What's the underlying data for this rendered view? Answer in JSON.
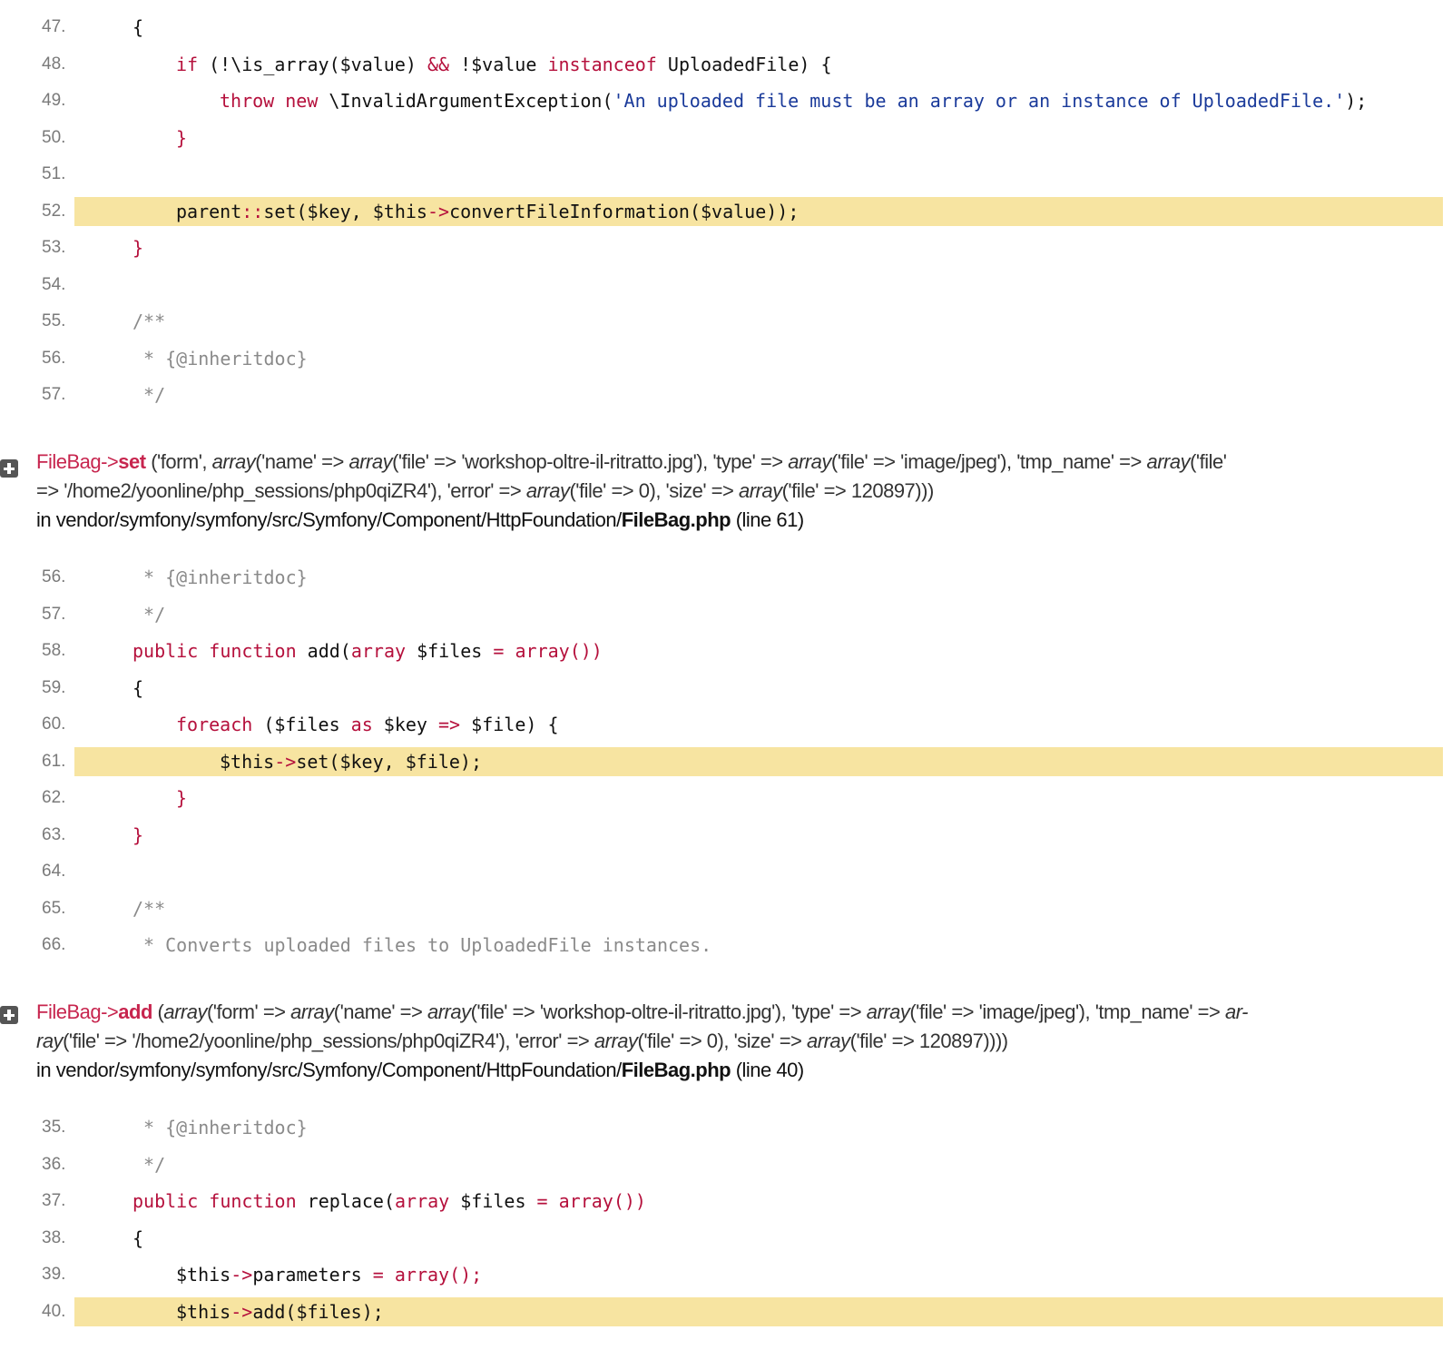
{
  "block1": {
    "lines": [
      {
        "n": "47.",
        "ind": 1,
        "hl": false,
        "tokens": [
          [
            "t",
            "{"
          ]
        ]
      },
      {
        "n": "48.",
        "ind": 2,
        "hl": false,
        "tokens": [
          [
            "k",
            "if"
          ],
          [
            "t",
            " (!\\is_array($value) "
          ],
          [
            "k",
            "&&"
          ],
          [
            "t",
            " !$value "
          ],
          [
            "k",
            "instanceof"
          ],
          [
            "t",
            " UploadedFile) {"
          ]
        ]
      },
      {
        "n": "49.",
        "ind": 3,
        "hl": false,
        "tokens": [
          [
            "k",
            "throw"
          ],
          [
            "t",
            " "
          ],
          [
            "k",
            "new"
          ],
          [
            "t",
            " \\InvalidArgumentException("
          ],
          [
            "s",
            "'An uploaded file must be an array or an instance of UploadedFile.'"
          ],
          [
            "t",
            ");"
          ]
        ]
      },
      {
        "n": "50.",
        "ind": 2,
        "hl": false,
        "tokens": [
          [
            "k",
            "}"
          ]
        ]
      },
      {
        "n": "51.",
        "ind": 0,
        "hl": false,
        "tokens": []
      },
      {
        "n": "52.",
        "ind": 2,
        "hl": true,
        "tokens": [
          [
            "t",
            "parent"
          ],
          [
            "k",
            "::"
          ],
          [
            "t",
            "set($key, $this"
          ],
          [
            "k",
            "->"
          ],
          [
            "t",
            "convertFileInformation($value));"
          ]
        ]
      },
      {
        "n": "53.",
        "ind": 1,
        "hl": false,
        "tokens": [
          [
            "k",
            "}"
          ]
        ]
      },
      {
        "n": "54.",
        "ind": 0,
        "hl": false,
        "tokens": []
      },
      {
        "n": "55.",
        "ind": 1,
        "hl": false,
        "tokens": [
          [
            "c",
            "/**"
          ]
        ]
      },
      {
        "n": "56.",
        "ind": 1,
        "hl": false,
        "tokens": [
          [
            "c",
            " * {@inheritdoc}"
          ]
        ]
      },
      {
        "n": "57.",
        "ind": 1,
        "hl": false,
        "tokens": [
          [
            "c",
            " */"
          ]
        ]
      }
    ]
  },
  "frame1": {
    "cls": "FileBag",
    "arrow": "->",
    "fn": "set",
    "args_line1": " ('form', <i>array</i>('name' => <i>array</i>('file' => 'workshop-oltre-il-ritratto.jpg'), 'type' => <i>array</i>('file' => 'image/jpeg'), 'tmp_name' => <i>array</i>('file'",
    "args_line2": "=> '/home2/yoonline/php_sessions/php0qiZR4'), 'error' => <i>array</i>('file' => 0), 'size' => <i>array</i>('file' => 120897)))",
    "loc_prefix": "in vendor/symfony/symfony/src/Symfony/Component/HttpFoundation/",
    "loc_file": "FileBag.php",
    "loc_line": " (line 61)"
  },
  "block2": {
    "lines": [
      {
        "n": "56.",
        "ind": 1,
        "hl": false,
        "tokens": [
          [
            "c",
            " * {@inheritdoc}"
          ]
        ]
      },
      {
        "n": "57.",
        "ind": 1,
        "hl": false,
        "tokens": [
          [
            "c",
            " */"
          ]
        ]
      },
      {
        "n": "58.",
        "ind": 1,
        "hl": false,
        "tokens": [
          [
            "k",
            "public function"
          ],
          [
            "t",
            " add("
          ],
          [
            "k",
            "array"
          ],
          [
            "t",
            " $files "
          ],
          [
            "k",
            "="
          ],
          [
            "t",
            " "
          ],
          [
            "k",
            "array())"
          ]
        ]
      },
      {
        "n": "59.",
        "ind": 1,
        "hl": false,
        "tokens": [
          [
            "t",
            "{"
          ]
        ]
      },
      {
        "n": "60.",
        "ind": 2,
        "hl": false,
        "tokens": [
          [
            "k",
            "foreach"
          ],
          [
            "t",
            " ($files "
          ],
          [
            "k",
            "as"
          ],
          [
            "t",
            " $key "
          ],
          [
            "k",
            "=>"
          ],
          [
            "t",
            " $file) {"
          ]
        ]
      },
      {
        "n": "61.",
        "ind": 3,
        "hl": true,
        "tokens": [
          [
            "t",
            "$this"
          ],
          [
            "k",
            "->"
          ],
          [
            "t",
            "set($key, $file);"
          ]
        ]
      },
      {
        "n": "62.",
        "ind": 2,
        "hl": false,
        "tokens": [
          [
            "k",
            "}"
          ]
        ]
      },
      {
        "n": "63.",
        "ind": 1,
        "hl": false,
        "tokens": [
          [
            "k",
            "}"
          ]
        ]
      },
      {
        "n": "64.",
        "ind": 0,
        "hl": false,
        "tokens": []
      },
      {
        "n": "65.",
        "ind": 1,
        "hl": false,
        "tokens": [
          [
            "c",
            "/**"
          ]
        ]
      },
      {
        "n": "66.",
        "ind": 1,
        "hl": false,
        "tokens": [
          [
            "c",
            " * Converts uploaded files to UploadedFile instances."
          ]
        ]
      }
    ]
  },
  "frame2": {
    "cls": "FileBag",
    "arrow": "->",
    "fn": "add",
    "args_line1": " (<i>array</i>('form' => <i>array</i>('name' => <i>array</i>('file' => 'workshop-oltre-il-ritratto.jpg'), 'type' => <i>array</i>('file' => 'image/jpeg'), 'tmp_name' => <i>ar-</i>",
    "args_line2": "<i>ray</i>('file' => '/home2/yoonline/php_sessions/php0qiZR4'), 'error' => <i>array</i>('file' => 0), 'size' => <i>array</i>('file' => 120897))))",
    "loc_prefix": "in vendor/symfony/symfony/src/Symfony/Component/HttpFoundation/",
    "loc_file": "FileBag.php",
    "loc_line": " (line 40)"
  },
  "block3": {
    "lines": [
      {
        "n": "35.",
        "ind": 1,
        "hl": false,
        "tokens": [
          [
            "c",
            " * {@inheritdoc}"
          ]
        ]
      },
      {
        "n": "36.",
        "ind": 1,
        "hl": false,
        "tokens": [
          [
            "c",
            " */"
          ]
        ]
      },
      {
        "n": "37.",
        "ind": 1,
        "hl": false,
        "tokens": [
          [
            "k",
            "public function"
          ],
          [
            "t",
            " replace("
          ],
          [
            "k",
            "array"
          ],
          [
            "t",
            " $files "
          ],
          [
            "k",
            "="
          ],
          [
            "t",
            " "
          ],
          [
            "k",
            "array())"
          ]
        ]
      },
      {
        "n": "38.",
        "ind": 1,
        "hl": false,
        "tokens": [
          [
            "t",
            "{"
          ]
        ]
      },
      {
        "n": "39.",
        "ind": 2,
        "hl": false,
        "tokens": [
          [
            "t",
            "$this"
          ],
          [
            "k",
            "->"
          ],
          [
            "t",
            "parameters "
          ],
          [
            "k",
            "="
          ],
          [
            "t",
            " "
          ],
          [
            "k",
            "array();"
          ]
        ]
      },
      {
        "n": "40.",
        "ind": 2,
        "hl": true,
        "tokens": [
          [
            "t",
            "$this"
          ],
          [
            "k",
            "->"
          ],
          [
            "t",
            "add($files);"
          ]
        ]
      }
    ]
  }
}
